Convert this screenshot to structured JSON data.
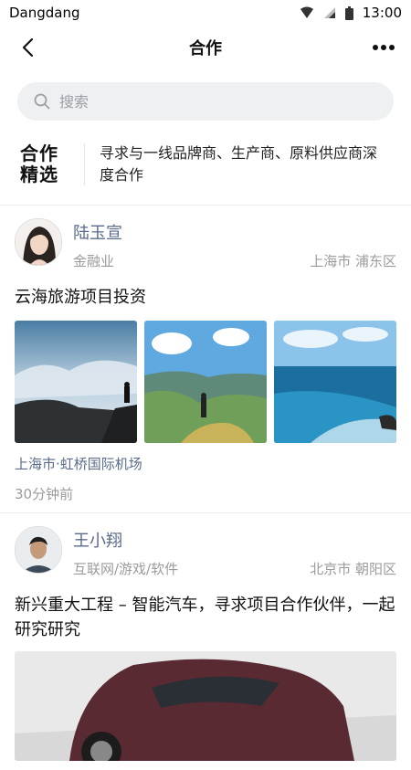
{
  "status": {
    "carrier": "Dangdang",
    "time": "13:00"
  },
  "nav": {
    "title": "合作"
  },
  "search": {
    "placeholder": "搜索"
  },
  "banner": {
    "logo_line1": "合作",
    "logo_line2": "精选",
    "text": "寻求与一线品牌商、生产商、原料供应商深度合作"
  },
  "posts": [
    {
      "name": "陆玉宣",
      "industry": "金融业",
      "city": "上海市",
      "district": "浦东区",
      "title": "云海旅游项目投资",
      "location": "上海市·虹桥国际机场",
      "time": "30分钟前"
    },
    {
      "name": "王小翔",
      "industry": "互联网/游戏/软件",
      "city": "北京市",
      "district": "朝阳区",
      "title": "新兴重大工程 – 智能汽车，寻求项目合作伙伴，一起研究研究"
    }
  ],
  "icons": [
    "back-icon",
    "more-icon",
    "search-icon",
    "wifi-icon",
    "signal-icon",
    "battery-icon"
  ]
}
